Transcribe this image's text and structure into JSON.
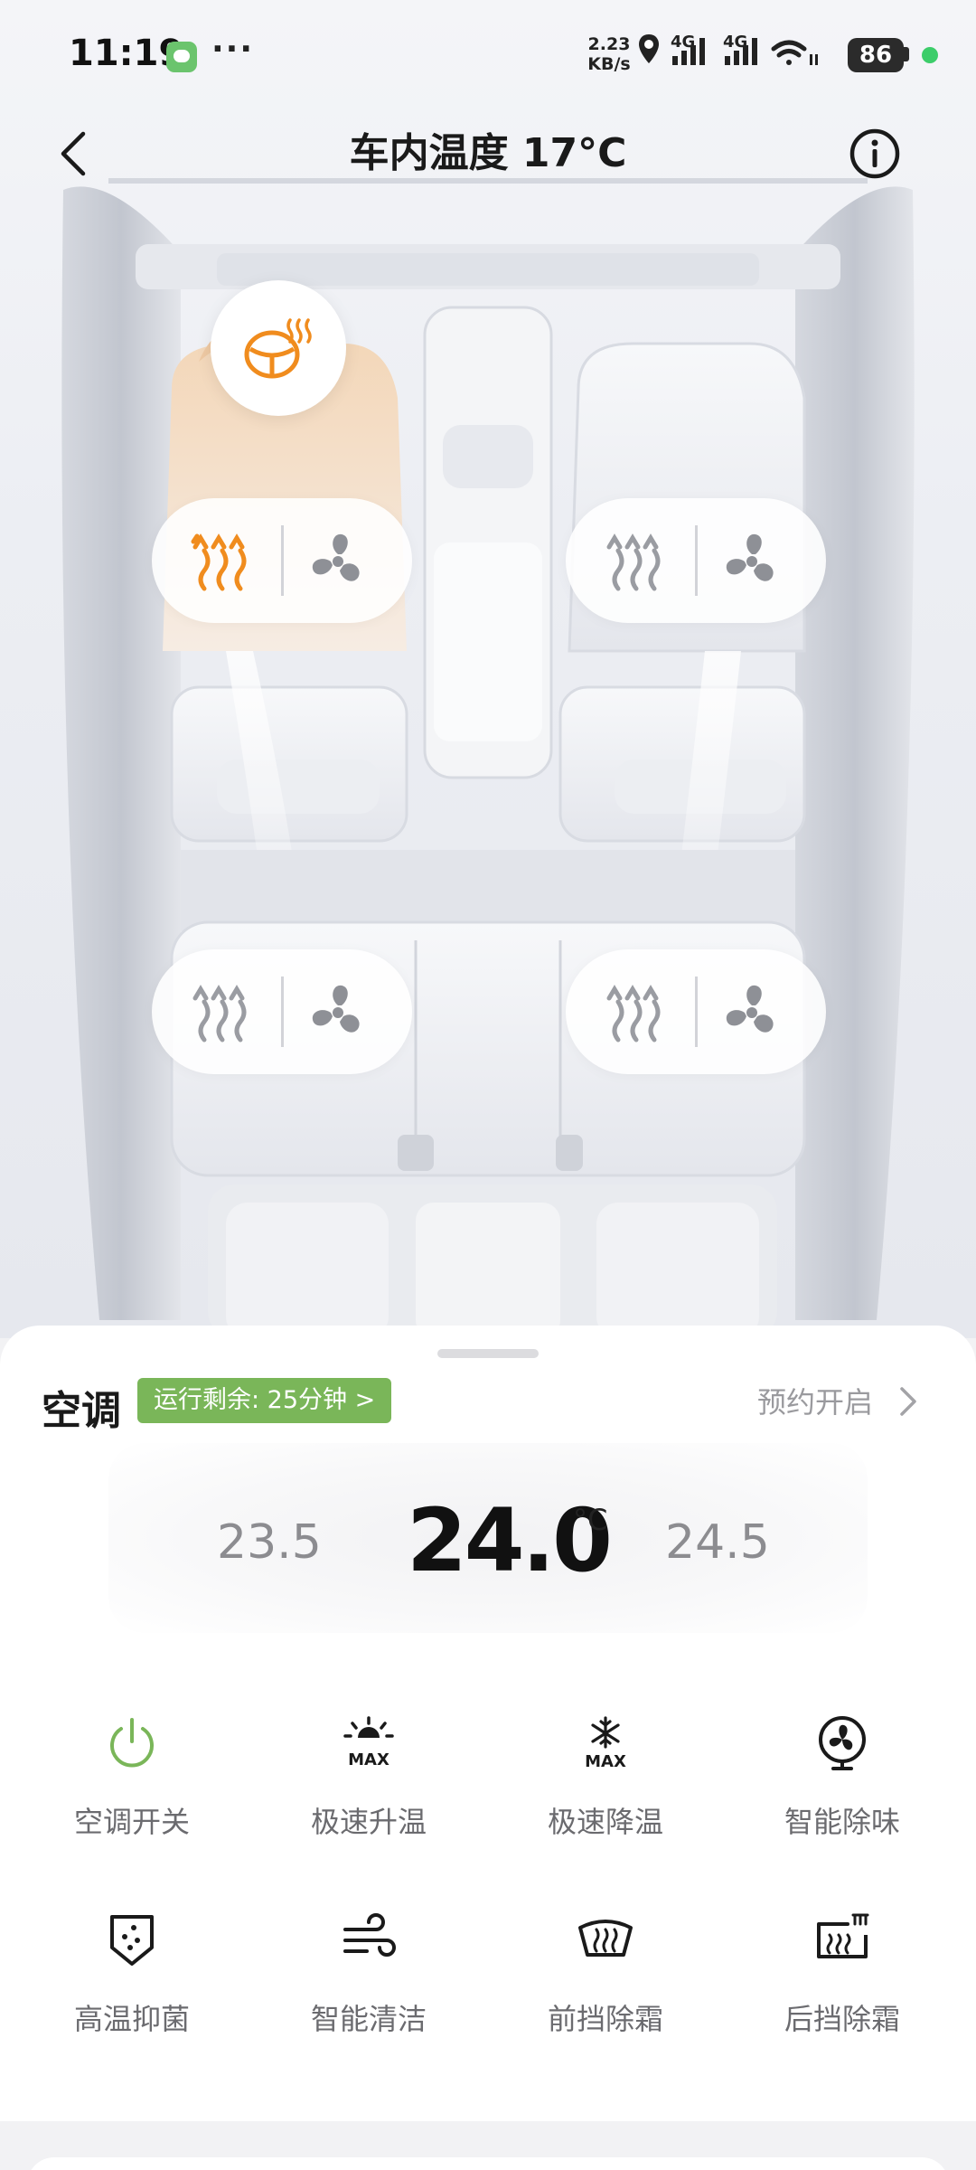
{
  "status_bar": {
    "time": "11:19",
    "dots": "···",
    "net_speed_value": "2.23",
    "net_speed_unit": "KB/s",
    "network_1": "4G",
    "network_2": "4G",
    "battery": "86"
  },
  "header": {
    "title": "车内温度 17°C"
  },
  "seats": {
    "driver": {
      "heat_active": true
    },
    "passenger": {
      "heat_active": false
    },
    "rear_left": {
      "heat_active": false
    },
    "rear_right": {
      "heat_active": false
    }
  },
  "ac": {
    "title": "空调",
    "runtime_label": "运行剩余: 25分钟 >",
    "schedule_label": "预约开启",
    "temp_low": "23.5",
    "temp_current": "24.0",
    "temp_unit": "°C",
    "temp_high": "24.5"
  },
  "functions": [
    {
      "label": "空调开关",
      "icon": "power-icon"
    },
    {
      "label": "极速升温",
      "icon": "sun-max-icon"
    },
    {
      "label": "极速降温",
      "icon": "snowflake-max-icon"
    },
    {
      "label": "智能除味",
      "icon": "fan-circle-icon"
    },
    {
      "label": "高温抑菌",
      "icon": "shield-dots-icon"
    },
    {
      "label": "智能清洁",
      "icon": "wind-icon"
    },
    {
      "label": "前挡除霜",
      "icon": "front-defrost-icon"
    },
    {
      "label": "后挡除霜",
      "icon": "rear-defrost-icon"
    }
  ],
  "colors": {
    "accent_green": "#7ab659",
    "heat_orange": "#f08c1e",
    "seat_highlight": "#f1d9c0"
  }
}
